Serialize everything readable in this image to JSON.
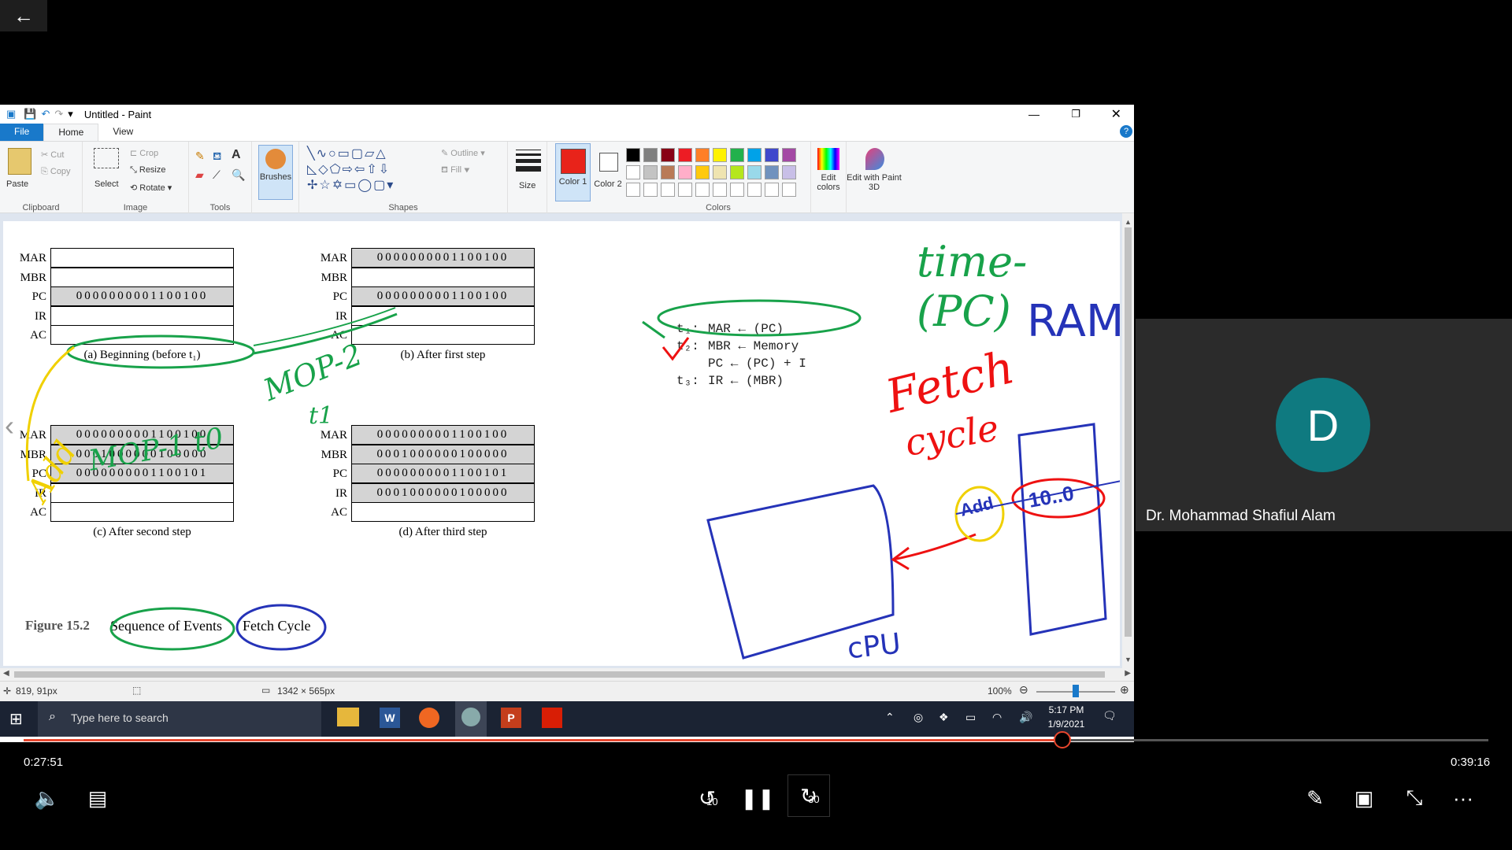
{
  "player": {
    "elapsed": "0:27:51",
    "duration": "0:39:16",
    "progress": 0.709,
    "rewind_label": "10",
    "forward_label": "30"
  },
  "participant": {
    "initial": "D",
    "name": "Dr. Mohammad Shafiul Alam",
    "avatar_color": "#0f7a80"
  },
  "paint": {
    "title": "Untitled - Paint",
    "menu": [
      "File",
      "Home",
      "View"
    ],
    "ribbon": {
      "clipboard": {
        "paste": "Paste",
        "cut": "Cut",
        "copy": "Copy",
        "label": "Clipboard"
      },
      "image": {
        "select": "Select",
        "crop": "Crop",
        "resize": "Resize",
        "rotate": "Rotate",
        "label": "Image"
      },
      "tools": {
        "label": "Tools"
      },
      "brushes": "Brushes",
      "shapes": {
        "outline": "Outline",
        "fill": "Fill",
        "label": "Shapes"
      },
      "size": "Size",
      "color1": "Color 1",
      "color2": "Color 2",
      "colors_label": "Colors",
      "edit_colors": "Edit colors",
      "edit_paint3d": "Edit with Paint 3D",
      "active_color": "#e8231a"
    },
    "status": {
      "cursor": "819, 91px",
      "size": "1342 × 565px",
      "zoom": "100%"
    }
  },
  "figure": {
    "panels": [
      {
        "caption": "(a) Beginning (before t₁)",
        "regs": [
          [
            "MAR",
            ""
          ],
          [
            "MBR",
            ""
          ],
          [
            "PC",
            "0000000001100100"
          ],
          [
            "IR",
            ""
          ],
          [
            "AC",
            ""
          ]
        ]
      },
      {
        "caption": "(b) After first step",
        "regs": [
          [
            "MAR",
            "0000000001100100"
          ],
          [
            "MBR",
            ""
          ],
          [
            "PC",
            "0000000001100100"
          ],
          [
            "IR",
            ""
          ],
          [
            "AC",
            ""
          ]
        ]
      },
      {
        "caption": "(c) After second step",
        "regs": [
          [
            "MAR",
            "0000000001100100"
          ],
          [
            "MBR",
            "0001000000100000"
          ],
          [
            "PC",
            "0000000001100101"
          ],
          [
            "IR",
            ""
          ],
          [
            "AC",
            ""
          ]
        ]
      },
      {
        "caption": "(d) After third step",
        "regs": [
          [
            "MAR",
            "0000000001100100"
          ],
          [
            "MBR",
            "0001000000100000"
          ],
          [
            "PC",
            "0000000001100101"
          ],
          [
            "IR",
            "0001000000100000"
          ],
          [
            "AC",
            ""
          ]
        ]
      }
    ],
    "figure_label": "Figure 15.2",
    "figure_title_a": "Sequence of Events",
    "figure_title_b": "Fetch Cycle",
    "micro_ops": [
      {
        "t": "t₁:",
        "op": "MAR ← (PC)"
      },
      {
        "t": "t₂:",
        "op": "MBR ← Memory"
      },
      {
        "t": "",
        "op": "PC ← (PC) + I"
      },
      {
        "t": "t₃:",
        "op": "IR ← (MBR)"
      }
    ]
  },
  "annotations": {
    "time_pc": "time-(PC)",
    "ram": "RAM",
    "fetch": "Fetch",
    "cycle": "cycle",
    "cpu": "cPU",
    "add": "Add",
    "addr_value": "10..0",
    "mop2": "MOP-2",
    "t1": "t1",
    "mop1": "MOP-1 t0",
    "addr_left": "Add"
  },
  "taskbar": {
    "search_placeholder": "Type here to search",
    "time": "5:17 PM",
    "date": "1/9/2021"
  }
}
